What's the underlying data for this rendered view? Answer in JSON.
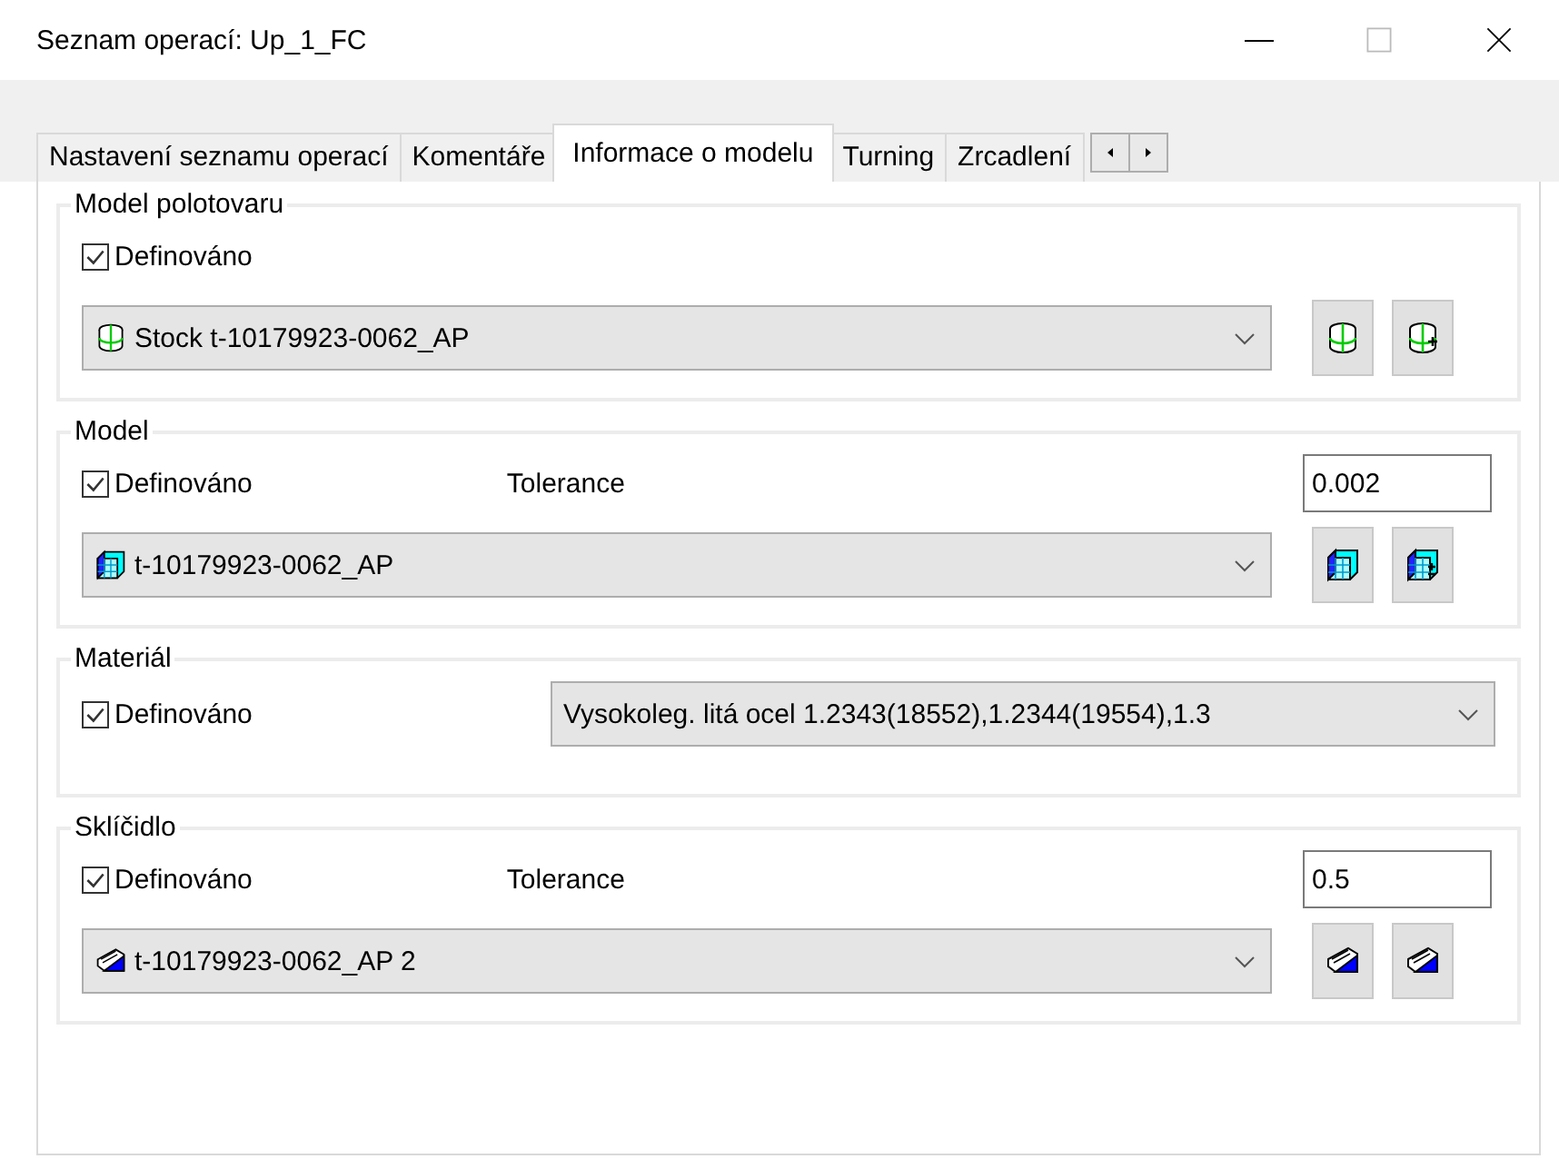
{
  "window": {
    "title": "Seznam operací:  Up_1_FC"
  },
  "tabs": [
    {
      "label": "Nastavení seznamu operací",
      "selected": false
    },
    {
      "label": "Komentáře",
      "selected": false
    },
    {
      "label": "Informace o modelu",
      "selected": true
    },
    {
      "label": "Turning",
      "selected": false
    },
    {
      "label": "Zrcadlení",
      "selected": false
    }
  ],
  "sections": [
    {
      "kind": "stacked",
      "title": "Model polotovaru",
      "checkbox": {
        "label": "Definováno",
        "checked": true
      },
      "combo": {
        "value": "Stock t-10179923-0062_AP"
      }
    },
    {
      "kind": "stacked",
      "title": "Model",
      "checkbox": {
        "label": "Definováno",
        "checked": true
      },
      "tolerance": {
        "label": "Tolerance",
        "value": "0.002"
      },
      "combo": {
        "value": "t-10179923-0062_AP"
      }
    },
    {
      "kind": "inline",
      "title": "Materiál",
      "checkbox": {
        "label": "Definováno",
        "checked": true
      },
      "combo": {
        "value": "Vysokoleg. litá ocel 1.2343(18552),1.2344(19554),1.3"
      }
    },
    {
      "kind": "stacked",
      "title": "Sklíčidlo",
      "checkbox": {
        "label": "Definováno",
        "checked": true
      },
      "tolerance": {
        "label": "Tolerance",
        "value": "0.5"
      },
      "combo": {
        "value": "t-10179923-0062_AP 2"
      }
    }
  ]
}
